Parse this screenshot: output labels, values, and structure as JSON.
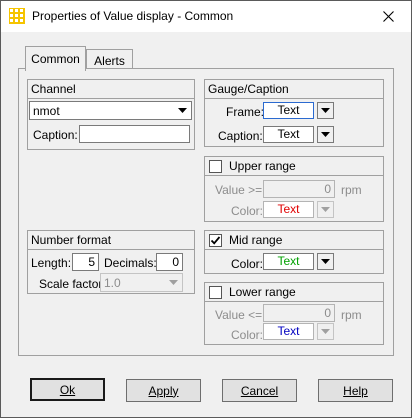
{
  "window": {
    "title": "Properties of Value display - Common"
  },
  "tabs": [
    {
      "label": "Common",
      "active": true
    },
    {
      "label": "Alerts",
      "active": false
    }
  ],
  "channel": {
    "header": "Channel",
    "selected": "nmot",
    "caption_label": "Caption:",
    "caption_value": ""
  },
  "number_format": {
    "header": "Number format",
    "length_label": "Length:",
    "length_value": "5",
    "decimals_label": "Decimals:",
    "decimals_value": "0",
    "scale_label": "Scale factor",
    "scale_value": "1.0"
  },
  "gauge": {
    "header": "Gauge/Caption",
    "frame_label": "Frame:",
    "frame_value": "Text",
    "caption_label": "Caption:",
    "caption_value": "Text"
  },
  "upper_range": {
    "header": "Upper range",
    "checked": false,
    "value_label": "Value >=",
    "value": "0",
    "unit": "rpm",
    "color_label": "Color:",
    "color_value": "Text",
    "color": "#e00000"
  },
  "mid_range": {
    "header": "Mid range",
    "checked": true,
    "color_label": "Color:",
    "color_value": "Text",
    "color": "#00a000"
  },
  "lower_range": {
    "header": "Lower range",
    "checked": false,
    "value_label": "Value <=",
    "value": "0",
    "unit": "rpm",
    "color_label": "Color:",
    "color_value": "Text",
    "color": "#0000c0"
  },
  "buttons": {
    "ok": "Ok",
    "apply": "Apply",
    "cancel": "Cancel",
    "help": "Help"
  },
  "icons": {
    "app": "app-grid-icon",
    "close": "close-icon",
    "dropdown": "chevron-down-icon",
    "check": "checkmark-icon"
  }
}
